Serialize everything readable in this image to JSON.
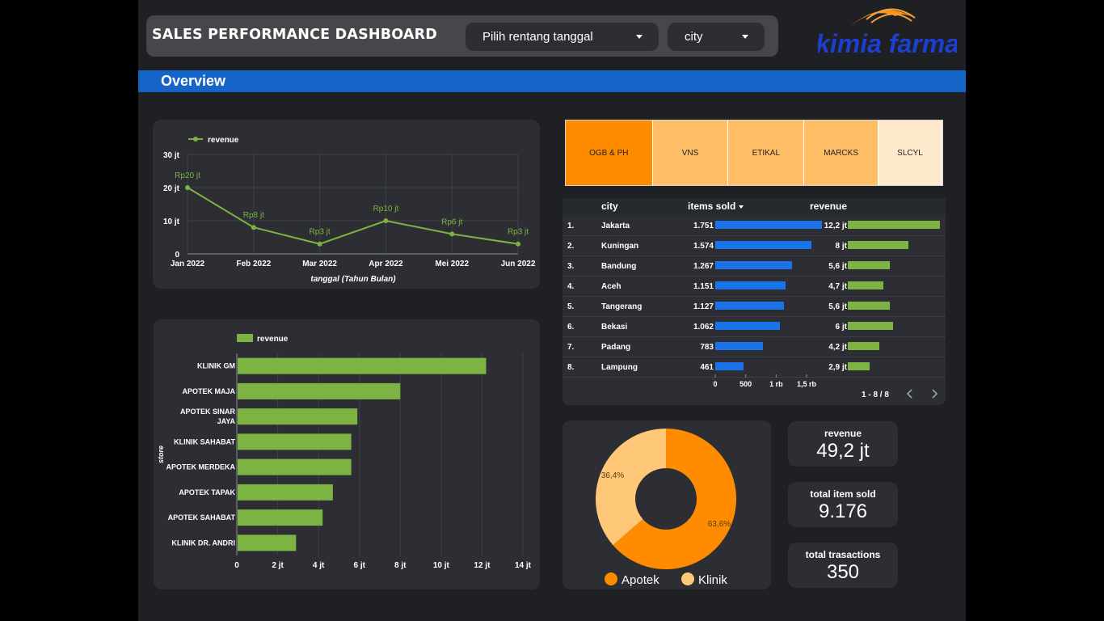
{
  "header": {
    "title": "SALES PERFORMANCE DASHBOARD",
    "date_filter": "Pilih rentang tanggal",
    "city_filter": "city",
    "logo_text": "kimia farma"
  },
  "section": {
    "overview": "Overview"
  },
  "line_chart": {
    "legend": "revenue",
    "xlabel": "tanggal (Tahun Bulan)",
    "yticks": [
      "30 jt",
      "20 jt",
      "10 jt",
      "0"
    ],
    "chart_data": {
      "type": "line",
      "categories": [
        "Jan 2022",
        "Feb 2022",
        "Mar 2022",
        "Apr 2022",
        "Mei 2022",
        "Jun 2022"
      ],
      "series": [
        {
          "name": "revenue",
          "values": [
            20,
            8,
            3,
            10,
            6,
            3
          ]
        }
      ],
      "data_labels": [
        "Rp20 jt",
        "Rp8 jt",
        "Rp3 jt",
        "Rp10 jt",
        "Rp6 jt",
        "Rp3 jt"
      ],
      "xlabel": "tanggal (Tahun Bulan)",
      "ylim": [
        0,
        30
      ],
      "y_unit": "jt"
    }
  },
  "bar_chart": {
    "legend": "revenue",
    "ylabel": "store",
    "xticks": [
      "0",
      "2 jt",
      "4 jt",
      "6 jt",
      "8 jt",
      "10 jt",
      "12 jt",
      "14 jt"
    ],
    "chart_data": {
      "type": "bar",
      "orientation": "horizontal",
      "categories": [
        "KLINIK GM",
        "APOTEK MAJA",
        "APOTEK SINAR JAYA",
        "KLINIK SAHABAT",
        "APOTEK MERDEKA",
        "APOTEK TAPAK",
        "APOTEK SAHABAT",
        "KLINIK DR. ANDRI"
      ],
      "category_lines": [
        [
          "KLINIK GM"
        ],
        [
          "APOTEK MAJA"
        ],
        [
          "APOTEK SINAR",
          "JAYA"
        ],
        [
          "KLINIK SAHABAT"
        ],
        [
          "APOTEK MERDEKA"
        ],
        [
          "APOTEK TAPAK"
        ],
        [
          "APOTEK SAHABAT"
        ],
        [
          "KLINIK DR. ANDRI"
        ]
      ],
      "series": [
        {
          "name": "revenue",
          "values": [
            12.2,
            8.0,
            5.9,
            5.6,
            5.6,
            4.7,
            4.2,
            2.9
          ]
        }
      ],
      "ylabel": "store",
      "xlim": [
        0,
        14
      ],
      "x_unit": "jt"
    }
  },
  "treemap": {
    "items": [
      {
        "label": "OGB & PH",
        "color": "#ff8c00",
        "flex": 108
      },
      {
        "label": "VNS",
        "color": "#ffbd66",
        "flex": 94
      },
      {
        "label": "ETIKAL",
        "color": "#ffbd66",
        "flex": 94
      },
      {
        "label": "MARCKS",
        "color": "#ffbd66",
        "flex": 92
      },
      {
        "label": "SLCYL",
        "color": "#ffe9cc",
        "flex": 79
      }
    ]
  },
  "city_table": {
    "headers": {
      "city": "city",
      "items": "items sold",
      "revenue": "revenue"
    },
    "rows": [
      {
        "rank": "1.",
        "city": "Jakarta",
        "items": "1.751",
        "items_val": 1751,
        "revenue": "12,2 jt",
        "revenue_val": 12.2
      },
      {
        "rank": "2.",
        "city": "Kuningan",
        "items": "1.574",
        "items_val": 1574,
        "revenue": "8 jt",
        "revenue_val": 8
      },
      {
        "rank": "3.",
        "city": "Bandung",
        "items": "1.267",
        "items_val": 1267,
        "revenue": "5,6 jt",
        "revenue_val": 5.6
      },
      {
        "rank": "4.",
        "city": "Aceh",
        "items": "1.151",
        "items_val": 1151,
        "revenue": "4,7 jt",
        "revenue_val": 4.7
      },
      {
        "rank": "5.",
        "city": "Tangerang",
        "items": "1.127",
        "items_val": 1127,
        "revenue": "5,6 jt",
        "revenue_val": 5.6
      },
      {
        "rank": "6.",
        "city": "Bekasi",
        "items": "1.062",
        "items_val": 1062,
        "revenue": "6 jt",
        "revenue_val": 6
      },
      {
        "rank": "7.",
        "city": "Padang",
        "items": "783",
        "items_val": 783,
        "revenue": "4,2 jt",
        "revenue_val": 4.2
      },
      {
        "rank": "8.",
        "city": "Lampung",
        "items": "461",
        "items_val": 461,
        "revenue": "2,9 jt",
        "revenue_val": 2.9
      }
    ],
    "axis_ticks": [
      "0",
      "500",
      "1 rb",
      "1,5 rb"
    ],
    "pagination": "1 - 8 / 8"
  },
  "donut": {
    "chart_data": {
      "type": "pie",
      "categories": [
        "Apotek",
        "Klinik"
      ],
      "values": [
        63.6,
        36.4
      ],
      "labels": [
        "63,6%",
        "36,4%"
      ],
      "colors": [
        "#ff8c00",
        "#ffc878"
      ]
    }
  },
  "kpis": [
    {
      "label": "revenue",
      "value": "49,2 jt"
    },
    {
      "label": "total item sold",
      "value": "9.176"
    },
    {
      "label": "total trasactions",
      "value": "350"
    }
  ],
  "colors": {
    "accent_blue": "#1565c8",
    "bar_green": "#7cb342",
    "bar_blue": "#1a73e8",
    "orange": "#ff8c00"
  }
}
